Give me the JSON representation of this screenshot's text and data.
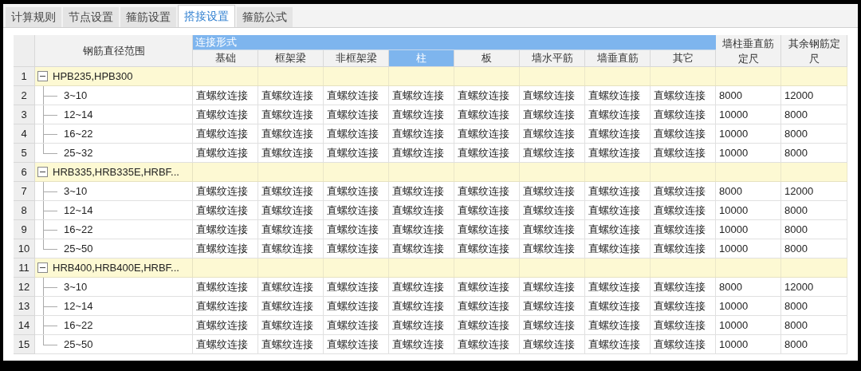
{
  "tabs": [
    {
      "label": "计算规则",
      "selected": false
    },
    {
      "label": "节点设置",
      "selected": false
    },
    {
      "label": "箍筋设置",
      "selected": false
    },
    {
      "label": "搭接设置",
      "selected": true
    },
    {
      "label": "箍筋公式",
      "selected": false
    }
  ],
  "table": {
    "range_header": "钢筋直径范围",
    "group_header": "连接形式",
    "columns": [
      {
        "label": "基础",
        "selected": false
      },
      {
        "label": "框架梁",
        "selected": false
      },
      {
        "label": "非框架梁",
        "selected": false
      },
      {
        "label": "柱",
        "selected": true
      },
      {
        "label": "板",
        "selected": false
      },
      {
        "label": "墙水平筋",
        "selected": false
      },
      {
        "label": "墙垂直筋",
        "selected": false
      },
      {
        "label": "其它",
        "selected": false
      }
    ],
    "extra_headers": [
      {
        "line1": "墙柱垂直筋",
        "line2": "定尺"
      },
      {
        "line1": "其余钢筋定",
        "line2": "尺"
      }
    ],
    "groups": [
      {
        "no": "1",
        "label": "HPB235,HPB300",
        "expanded": true,
        "children": [
          {
            "no": "2",
            "range": "3~10",
            "cells": [
              "直螺纹连接",
              "直螺纹连接",
              "直螺纹连接",
              "直螺纹连接",
              "直螺纹连接",
              "直螺纹连接",
              "直螺纹连接",
              "直螺纹连接",
              "8000",
              "12000"
            ]
          },
          {
            "no": "3",
            "range": "12~14",
            "cells": [
              "直螺纹连接",
              "直螺纹连接",
              "直螺纹连接",
              "直螺纹连接",
              "直螺纹连接",
              "直螺纹连接",
              "直螺纹连接",
              "直螺纹连接",
              "10000",
              "8000"
            ]
          },
          {
            "no": "4",
            "range": "16~22",
            "cells": [
              "直螺纹连接",
              "直螺纹连接",
              "直螺纹连接",
              "直螺纹连接",
              "直螺纹连接",
              "直螺纹连接",
              "直螺纹连接",
              "直螺纹连接",
              "10000",
              "8000"
            ]
          },
          {
            "no": "5",
            "range": "25~32",
            "cells": [
              "直螺纹连接",
              "直螺纹连接",
              "直螺纹连接",
              "直螺纹连接",
              "直螺纹连接",
              "直螺纹连接",
              "直螺纹连接",
              "直螺纹连接",
              "10000",
              "8000"
            ]
          }
        ]
      },
      {
        "no": "6",
        "label": "HRB335,HRB335E,HRBF...",
        "expanded": true,
        "children": [
          {
            "no": "7",
            "range": "3~10",
            "cells": [
              "直螺纹连接",
              "直螺纹连接",
              "直螺纹连接",
              "直螺纹连接",
              "直螺纹连接",
              "直螺纹连接",
              "直螺纹连接",
              "直螺纹连接",
              "8000",
              "12000"
            ]
          },
          {
            "no": "8",
            "range": "12~14",
            "cells": [
              "直螺纹连接",
              "直螺纹连接",
              "直螺纹连接",
              "直螺纹连接",
              "直螺纹连接",
              "直螺纹连接",
              "直螺纹连接",
              "直螺纹连接",
              "10000",
              "8000"
            ]
          },
          {
            "no": "9",
            "range": "16~22",
            "cells": [
              "直螺纹连接",
              "直螺纹连接",
              "直螺纹连接",
              "直螺纹连接",
              "直螺纹连接",
              "直螺纹连接",
              "直螺纹连接",
              "直螺纹连接",
              "10000",
              "8000"
            ]
          },
          {
            "no": "10",
            "range": "25~50",
            "cells": [
              "直螺纹连接",
              "直螺纹连接",
              "直螺纹连接",
              "直螺纹连接",
              "直螺纹连接",
              "直螺纹连接",
              "直螺纹连接",
              "直螺纹连接",
              "10000",
              "8000"
            ]
          }
        ]
      },
      {
        "no": "11",
        "label": "HRB400,HRB400E,HRBF...",
        "expanded": true,
        "children": [
          {
            "no": "12",
            "range": "3~10",
            "cells": [
              "直螺纹连接",
              "直螺纹连接",
              "直螺纹连接",
              "直螺纹连接",
              "直螺纹连接",
              "直螺纹连接",
              "直螺纹连接",
              "直螺纹连接",
              "8000",
              "12000"
            ]
          },
          {
            "no": "13",
            "range": "12~14",
            "cells": [
              "直螺纹连接",
              "直螺纹连接",
              "直螺纹连接",
              "直螺纹连接",
              "直螺纹连接",
              "直螺纹连接",
              "直螺纹连接",
              "直螺纹连接",
              "10000",
              "8000"
            ]
          },
          {
            "no": "14",
            "range": "16~22",
            "cells": [
              "直螺纹连接",
              "直螺纹连接",
              "直螺纹连接",
              "直螺纹连接",
              "直螺纹连接",
              "直螺纹连接",
              "直螺纹连接",
              "直螺纹连接",
              "10000",
              "8000"
            ]
          },
          {
            "no": "15",
            "range": "25~50",
            "cells": [
              "直螺纹连接",
              "直螺纹连接",
              "直螺纹连接",
              "直螺纹连接",
              "直螺纹连接",
              "直螺纹连接",
              "直螺纹连接",
              "直螺纹连接",
              "10000",
              "8000"
            ]
          }
        ]
      }
    ]
  }
}
